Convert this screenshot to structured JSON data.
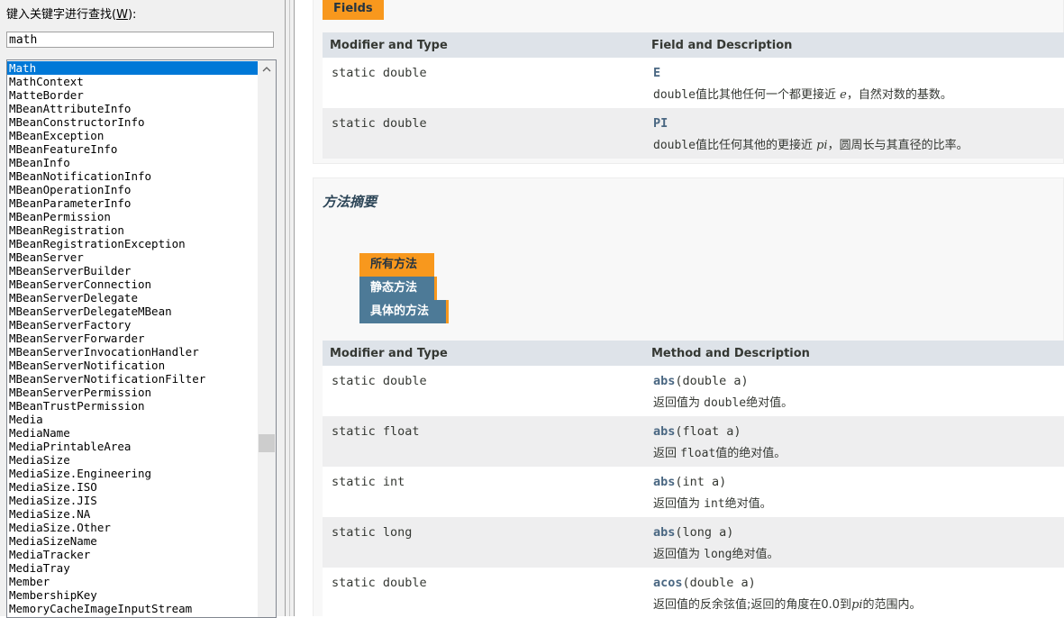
{
  "left_panel": {
    "search_label_prefix": "键入关键字进行查找(",
    "search_label_accel": "W",
    "search_label_suffix": "):",
    "search_value": "math",
    "scroll_up_icon": "chevron-up-icon",
    "items": [
      "Math",
      "MathContext",
      "MatteBorder",
      "MBeanAttributeInfo",
      "MBeanConstructorInfo",
      "MBeanException",
      "MBeanFeatureInfo",
      "MBeanInfo",
      "MBeanNotificationInfo",
      "MBeanOperationInfo",
      "MBeanParameterInfo",
      "MBeanPermission",
      "MBeanRegistration",
      "MBeanRegistrationException",
      "MBeanServer",
      "MBeanServerBuilder",
      "MBeanServerConnection",
      "MBeanServerDelegate",
      "MBeanServerDelegateMBean",
      "MBeanServerFactory",
      "MBeanServerForwarder",
      "MBeanServerInvocationHandler",
      "MBeanServerNotification",
      "MBeanServerNotificationFilter",
      "MBeanServerPermission",
      "MBeanTrustPermission",
      "Media",
      "MediaName",
      "MediaPrintableArea",
      "MediaSize",
      "MediaSize.Engineering",
      "MediaSize.ISO",
      "MediaSize.JIS",
      "MediaSize.NA",
      "MediaSize.Other",
      "MediaSizeName",
      "MediaTracker",
      "MediaTray",
      "Member",
      "MembershipKey",
      "MemoryCacheImageInputStream"
    ],
    "selected_index": 0
  },
  "fields": {
    "tab_label": "Fields",
    "col1": "Modifier and Type",
    "col2": "Field and Description",
    "rows": [
      {
        "type": "static double",
        "name": "E",
        "desc_pre": "double",
        "desc_mid": "值比其他任何一个都更接近 ",
        "desc_ital": "e",
        "desc_post": "，自然对数的基数。"
      },
      {
        "type": "static double",
        "name": "PI",
        "desc_pre": "double",
        "desc_mid": "值比任何其他的更接近 ",
        "desc_ital": "pi",
        "desc_post": "，圆周长与其直径的比率。"
      }
    ]
  },
  "methods": {
    "title": "方法摘要",
    "tabs": [
      "所有方法",
      "静态方法",
      "具体的方法"
    ],
    "col1": "Modifier and Type",
    "col2": "Method and Description",
    "rows": [
      {
        "type": "static double",
        "name": "abs",
        "args": "(double a)",
        "desc_a": "返回值为 ",
        "desc_b": "double",
        "desc_c": "绝对值。"
      },
      {
        "type": "static float",
        "name": "abs",
        "args": "(float a)",
        "desc_a": "返回 ",
        "desc_b": "float",
        "desc_c": "值的绝对值。"
      },
      {
        "type": "static int",
        "name": "abs",
        "args": "(int a)",
        "desc_a": "返回值为 ",
        "desc_b": "int",
        "desc_c": "绝对值。"
      },
      {
        "type": "static long",
        "name": "abs",
        "args": "(long a)",
        "desc_a": "返回值为 ",
        "desc_b": "long",
        "desc_c": "绝对值。"
      },
      {
        "type": "static double",
        "name": "acos",
        "args": "(double a)",
        "desc_a": "返回值的反余弦值;返回的角度在0.0到",
        "desc_ital": "pi",
        "desc_c": "的范围内。"
      }
    ]
  }
}
